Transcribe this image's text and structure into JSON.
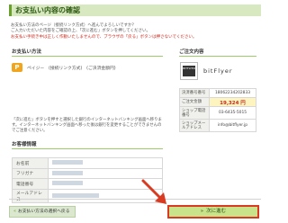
{
  "page": {
    "title": "お支払い内容の確認"
  },
  "notice": {
    "line1": "お支払い方法のページ（接続リンク方式）へ進んでよろしいですか？",
    "line2": "ご入力いただいた内容をご確認の上、「次に進む」ボタンを押してください。",
    "line3_red": "お支払い手続き中は正しく作動いたしませんので、ブラウザの「戻る」ボタンは押さないでください。"
  },
  "payment_method": {
    "heading": "お支払い方法",
    "logo_glyph": "P",
    "label": "ペイジー　(接続リンク方式)　(ご決済金額円)",
    "note": "「次に進む」ボタンを押すと選択した銀行のインターネットバンキング画面へ移ります。インターネットバンキング画面へ移った後は銀行を変更することができませんのでご注意ください。",
    "note_red": "ご注意ください。"
  },
  "customer": {
    "heading": "お客様情報",
    "rows": [
      {
        "label": "お名前"
      },
      {
        "label": "フリガナ"
      },
      {
        "label": "電話番号"
      },
      {
        "label": "メールアドレス"
      }
    ]
  },
  "shop": {
    "heading": "ご注文内容",
    "logo_text": "BITFLYER",
    "name": "bitFlyer",
    "rows": [
      {
        "label": "決済番号番号",
        "value": "18062234202833"
      },
      {
        "label": "ご注文金額",
        "value": "19,324 円"
      },
      {
        "label": "ショップ電話番号",
        "value": "03-6435-5015"
      },
      {
        "label": "ショップメールアドレス",
        "value": "info@bitflyer.jp"
      }
    ]
  },
  "buttons": {
    "back_label": "お支払い方法の選択へ戻る",
    "back_chevron": "«",
    "next_label": "次に進む",
    "next_chevron": "»"
  },
  "colors": {
    "accent_green": "#6aa12a",
    "highlight_red": "#d93a22",
    "amount_red": "#c92a1e"
  }
}
